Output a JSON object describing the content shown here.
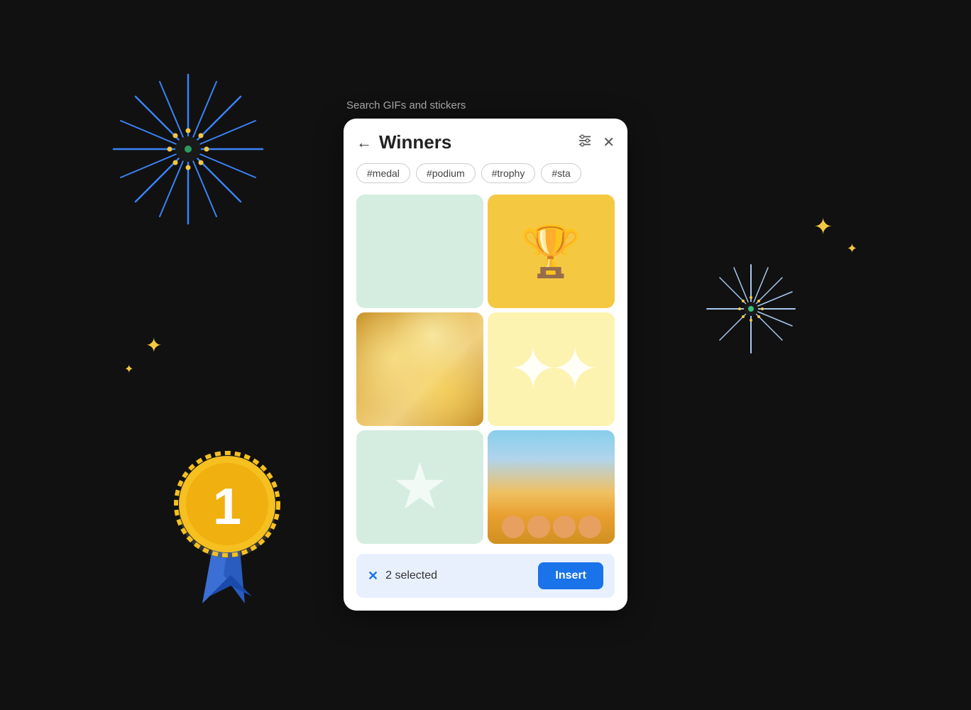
{
  "search_label": "Search GIFs and stickers",
  "header": {
    "back_label": "←",
    "title": "Winners",
    "close_label": "✕"
  },
  "tags": [
    "#medal",
    "#podium",
    "#trophy",
    "#sta"
  ],
  "grid": [
    {
      "id": "cell-mint",
      "type": "mint-empty"
    },
    {
      "id": "cell-trophy",
      "type": "yellow-trophy"
    },
    {
      "id": "cell-gold",
      "type": "gold-bokeh"
    },
    {
      "id": "cell-sparkles",
      "type": "sparkles"
    },
    {
      "id": "cell-star",
      "type": "star"
    },
    {
      "id": "cell-team",
      "type": "team"
    }
  ],
  "bottom_bar": {
    "selected_count": "2 selected",
    "insert_label": "Insert"
  },
  "colors": {
    "accent_blue": "#1a73e8",
    "panel_bg": "#ffffff",
    "tag_border": "#cccccc",
    "bottom_bar_bg": "#e8f0fe"
  }
}
